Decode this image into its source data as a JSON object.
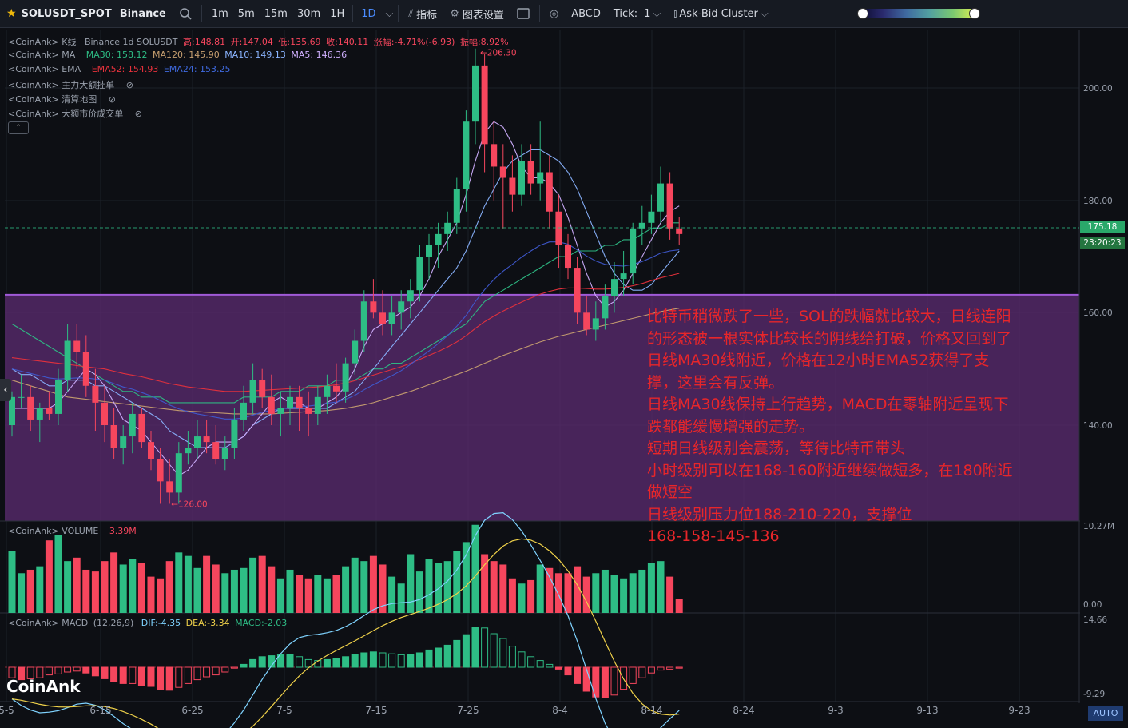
{
  "toolbar": {
    "symbol": "SOLUSDT_SPOT",
    "exchange": "Binance",
    "timeframes": [
      "1m",
      "5m",
      "15m",
      "30m",
      "1H",
      "1D"
    ],
    "active_timeframe": "1D",
    "indicators_label": "指标",
    "chart_settings_label": "图表设置",
    "abcd_label": "ABCD",
    "tick_label": "Tick:",
    "tick_value": "1",
    "cluster_label": "Ask-Bid Cluster"
  },
  "legends": {
    "kline": {
      "prefix": "<CoinAnk> K线",
      "source": "Binance 1d SOLUSDT",
      "high": "高:148.81",
      "open": "开:147.04",
      "low": "低:135.69",
      "close": "收:140.11",
      "change": "涨幅:-4.71%(-6.93)",
      "amplitude": "振幅:8.92%"
    },
    "ma": {
      "prefix": "<CoinAnk> MA",
      "ma30": "MA30: 158.12",
      "ma120": "MA120: 145.90",
      "ma10": "MA10: 149.13",
      "ma5": "MA5: 146.36"
    },
    "ema": {
      "prefix": "<CoinAnk> EMA",
      "ema52": "EMA52: 154.93",
      "ema24": "EMA24: 153.25"
    },
    "hidden": [
      "<CoinAnk> 主力大额挂单",
      "<CoinAnk> 清算地图",
      "<CoinAnk> 大额市价成交单"
    ],
    "volume": {
      "prefix": "<CoinAnk> VOLUME",
      "value": "3.39M"
    },
    "macd": {
      "prefix": "<CoinAnk> MACD",
      "params": "(12,26,9)",
      "dif": "DIF:-4.35",
      "dea": "DEA:-3.34",
      "macd": "MACD:-2.03"
    }
  },
  "price_axis": {
    "labels": [
      "200.00",
      "180.00",
      "160.00",
      "140.00"
    ],
    "current_price": "175.18",
    "countdown": "23:20:23"
  },
  "volume_axis": {
    "labels": [
      "10.27M",
      "0.00"
    ]
  },
  "macd_axis": {
    "labels": [
      "14.66",
      "-9.29"
    ]
  },
  "extremes": {
    "high_label": "206.30",
    "low_label": "126.00"
  },
  "date_axis": [
    "5-5",
    "6-15",
    "6-25",
    "7-5",
    "7-15",
    "7-25",
    "8-4",
    "8-14",
    "8-24",
    "9-3",
    "9-13",
    "9-23"
  ],
  "annotation": [
    "比特币稍微跌了一些，SOL的跌幅就比较大，日线连阳",
    "的形态被一根实体比较长的阴线给打破，价格又回到了",
    "日线MA30线附近，价格在12小时EMA52获得了支",
    "撑，这里会有反弹。",
    "日线MA30线保持上行趋势，MACD在零轴附近呈现下",
    "跌都能缓慢增强的走势。",
    "短期日线级别会震荡，等待比特币带头",
    "小时级别可以在168-160附近继续做短多，在180附近",
    "做短空",
    "日线级别压力位188-210-220，支撑位",
    "168-158-145-136"
  ],
  "logo": "CoinAnk",
  "auto_label": "AUTO",
  "colors": {
    "up": "#2ebd85",
    "down": "#f6465d",
    "zone": "#5a2a6e",
    "ma30": "#2ebd85",
    "ma120": "#c8a070",
    "ma10": "#8ab4ff",
    "ma5": "#d0b0ff",
    "ema52": "#e8323c",
    "ema24": "#3f5ad0"
  },
  "chart_data": {
    "type": "candlestick",
    "title": "Binance 1d SOLUSDT",
    "ylim": [
      120,
      210
    ],
    "zone": [
      129,
      163.2
    ],
    "candles": [
      [
        140,
        146,
        138,
        145
      ],
      [
        145,
        149,
        143,
        145
      ],
      [
        145,
        147,
        139,
        141
      ],
      [
        141,
        144,
        137,
        143
      ],
      [
        143,
        146,
        141,
        142
      ],
      [
        142,
        150,
        140,
        148
      ],
      [
        148,
        158,
        146,
        155
      ],
      [
        155,
        158,
        150,
        153
      ],
      [
        153,
        156,
        145,
        147
      ],
      [
        147,
        150,
        139,
        144
      ],
      [
        144,
        147,
        137,
        140
      ],
      [
        140,
        143,
        134,
        136
      ],
      [
        136,
        140,
        133,
        138
      ],
      [
        138,
        144,
        135,
        142
      ],
      [
        142,
        143,
        136,
        137
      ],
      [
        137,
        139,
        132,
        134
      ],
      [
        134,
        136,
        126,
        130
      ],
      [
        130,
        134,
        126,
        128
      ],
      [
        128,
        137,
        126,
        135
      ],
      [
        135,
        139,
        133,
        136
      ],
      [
        136,
        141,
        134,
        138
      ],
      [
        138,
        141,
        135,
        137
      ],
      [
        137,
        140,
        133,
        134
      ],
      [
        134,
        138,
        132,
        136
      ],
      [
        136,
        143,
        134,
        141
      ],
      [
        141,
        147,
        139,
        144
      ],
      [
        144,
        151,
        142,
        148
      ],
      [
        148,
        150,
        143,
        145
      ],
      [
        145,
        149,
        140,
        142
      ],
      [
        142,
        146,
        138,
        143
      ],
      [
        143,
        147,
        140,
        145
      ],
      [
        145,
        147,
        139,
        143
      ],
      [
        143,
        146,
        138,
        142
      ],
      [
        142,
        147,
        140,
        145
      ],
      [
        145,
        149,
        142,
        147
      ],
      [
        147,
        151,
        144,
        146
      ],
      [
        146,
        152,
        144,
        151
      ],
      [
        151,
        157,
        149,
        155
      ],
      [
        155,
        164,
        153,
        162
      ],
      [
        162,
        166,
        159,
        160
      ],
      [
        160,
        164,
        156,
        158
      ],
      [
        158,
        163,
        156,
        160
      ],
      [
        160,
        164,
        157,
        162
      ],
      [
        162,
        166,
        159,
        164
      ],
      [
        164,
        172,
        162,
        170
      ],
      [
        170,
        174,
        166,
        172
      ],
      [
        172,
        176,
        168,
        174
      ],
      [
        174,
        178,
        171,
        176
      ],
      [
        176,
        184,
        174,
        182
      ],
      [
        182,
        196,
        178,
        194
      ],
      [
        194,
        207,
        190,
        204
      ],
      [
        204,
        206,
        185,
        190
      ],
      [
        190,
        194,
        180,
        186
      ],
      [
        186,
        190,
        175,
        184
      ],
      [
        184,
        188,
        178,
        181
      ],
      [
        181,
        190,
        179,
        187
      ],
      [
        187,
        190,
        181,
        183
      ],
      [
        183,
        194,
        180,
        185
      ],
      [
        185,
        188,
        175,
        178
      ],
      [
        178,
        181,
        168,
        172
      ],
      [
        172,
        174,
        166,
        168
      ],
      [
        168,
        170,
        158,
        160
      ],
      [
        160,
        163,
        156,
        157
      ],
      [
        157,
        162,
        155,
        159
      ],
      [
        159,
        165,
        157,
        163
      ],
      [
        163,
        169,
        160,
        166
      ],
      [
        166,
        171,
        163,
        167
      ],
      [
        167,
        176,
        165,
        175
      ],
      [
        175,
        179,
        172,
        176
      ],
      [
        176,
        181,
        174,
        178
      ],
      [
        178,
        186,
        176,
        183
      ],
      [
        183,
        185,
        173,
        175
      ],
      [
        175,
        177,
        172,
        174
      ]
    ],
    "volume": [
      7.2,
      4.6,
      5.0,
      5.4,
      8.4,
      9.0,
      6.0,
      6.4,
      5.0,
      4.8,
      6.0,
      7.0,
      5.6,
      6.2,
      5.8,
      4.2,
      4.0,
      6.0,
      7.0,
      6.6,
      5.2,
      6.6,
      5.6,
      4.6,
      5.0,
      5.2,
      6.4,
      6.6,
      5.4,
      4.0,
      5.0,
      4.4,
      4.0,
      4.4,
      4.0,
      4.4,
      5.4,
      6.4,
      6.0,
      6.6,
      5.6,
      4.2,
      3.4,
      6.8,
      4.8,
      6.2,
      5.8,
      6.0,
      7.2,
      8.2,
      10.2,
      6.8,
      6.0,
      5.6,
      4.0,
      3.4,
      3.8,
      5.6,
      5.2,
      4.6,
      4.6,
      5.4,
      4.2,
      4.6,
      5.0,
      4.4,
      4.0,
      4.6,
      5.0,
      5.8,
      6.0,
      4.2,
      1.6
    ],
    "macd_hist": [
      -2.2,
      -2.6,
      -2.4,
      -2.2,
      -1.6,
      -1.4,
      -1.0,
      -0.8,
      -1.2,
      -1.8,
      -2.4,
      -3.0,
      -3.4,
      -3.4,
      -3.8,
      -4.0,
      -4.6,
      -4.8,
      -4.2,
      -3.4,
      -2.6,
      -2.0,
      -1.6,
      -1.0,
      -0.2,
      0.6,
      1.6,
      2.2,
      2.4,
      2.6,
      2.6,
      2.2,
      1.6,
      1.4,
      1.6,
      1.8,
      2.2,
      2.6,
      3.0,
      3.2,
      3.0,
      2.8,
      2.6,
      2.6,
      3.0,
      3.6,
      4.0,
      4.6,
      5.6,
      6.8,
      8.4,
      8.2,
      7.0,
      6.0,
      4.4,
      3.2,
      2.2,
      1.4,
      0.6,
      -0.4,
      -1.6,
      -3.4,
      -5.0,
      -6.2,
      -6.4,
      -5.8,
      -4.6,
      -3.4,
      -2.2,
      -1.2,
      -0.6,
      -0.4,
      -0.2
    ],
    "series": [
      {
        "name": "MA30",
        "color": "#2ebd85",
        "values": [
          158,
          157,
          156,
          155,
          154,
          153,
          152,
          151,
          150,
          149,
          148,
          147,
          146,
          146,
          145,
          145,
          145,
          144,
          144,
          144,
          144,
          144,
          144,
          144,
          144,
          145,
          145,
          145,
          145,
          146,
          146,
          146,
          147,
          147,
          147,
          148,
          148,
          148,
          149,
          150,
          150,
          151,
          151,
          152,
          153,
          154,
          155,
          156,
          157,
          158,
          160,
          162,
          163,
          164,
          165,
          166,
          167,
          168,
          169,
          170,
          170,
          171,
          171,
          171,
          172,
          172,
          173,
          173,
          174,
          175,
          175,
          176,
          176
        ]
      },
      {
        "name": "MA120",
        "color": "#c8a070",
        "values": [
          148,
          147.5,
          147,
          146.5,
          146,
          145.5,
          145,
          144.8,
          144.6,
          144.4,
          144.2,
          144,
          143.8,
          143.6,
          143.4,
          143.2,
          143,
          142.8,
          142.6,
          142.5,
          142.4,
          142.3,
          142.2,
          142.1,
          142,
          142,
          142,
          142,
          142,
          142.1,
          142.2,
          142.3,
          142.4,
          142.5,
          142.6,
          142.8,
          143,
          143.3,
          143.6,
          144,
          144.5,
          145,
          145.5,
          146,
          146.6,
          147.2,
          147.8,
          148.4,
          149,
          149.6,
          150.3,
          151,
          151.7,
          152.4,
          153,
          153.6,
          154.2,
          154.8,
          155.3,
          155.8,
          156.2,
          156.6,
          157,
          157.4,
          157.8,
          158.2,
          158.6,
          159,
          159.4,
          159.8,
          160.2,
          160.5,
          160.8
        ]
      },
      {
        "name": "MA10",
        "color": "#8ab4ff",
        "values": [
          150,
          149,
          149,
          148,
          147,
          147,
          148,
          148,
          148,
          147,
          147,
          146,
          145,
          144,
          143,
          142,
          141,
          139,
          138,
          137,
          136,
          136,
          136,
          136,
          137,
          138,
          140,
          141,
          142,
          143,
          143,
          143,
          143,
          143,
          143,
          144,
          145,
          146,
          148,
          150,
          152,
          154,
          156,
          158,
          160,
          162,
          164,
          166,
          168,
          171,
          175,
          179,
          182,
          185,
          187,
          188,
          189,
          189,
          188,
          187,
          185,
          182,
          178,
          174,
          170,
          167,
          165,
          164,
          164,
          165,
          167,
          169,
          171
        ]
      },
      {
        "name": "MA5",
        "color": "#d0b0ff",
        "values": [
          143,
          143,
          143,
          143,
          143,
          144,
          146,
          148,
          150,
          149,
          147,
          144,
          141,
          140,
          139,
          137,
          135,
          133,
          131,
          132,
          134,
          136,
          137,
          137,
          137,
          138,
          140,
          142,
          144,
          145,
          144,
          144,
          143,
          143,
          144,
          145,
          147,
          150,
          154,
          157,
          158,
          159,
          160,
          161,
          163,
          166,
          170,
          173,
          176,
          181,
          187,
          192,
          194,
          193,
          190,
          186,
          184,
          184,
          183,
          181,
          177,
          172,
          167,
          163,
          161,
          162,
          164,
          167,
          170,
          173,
          176,
          178,
          179
        ]
      },
      {
        "name": "EMA52",
        "color": "#e8323c",
        "values": [
          152,
          151.8,
          151.6,
          151.4,
          151.2,
          151,
          150.8,
          150.6,
          150.4,
          150.2,
          150,
          149.6,
          149.2,
          148.9,
          148.6,
          148.2,
          147.8,
          147.4,
          147.1,
          146.8,
          146.6,
          146.4,
          146.2,
          146,
          146,
          146,
          146.1,
          146.2,
          146.3,
          146.4,
          146.5,
          146.6,
          146.7,
          146.8,
          147,
          147.2,
          147.5,
          147.9,
          148.4,
          148.9,
          149.4,
          149.9,
          150.4,
          151,
          151.7,
          152.4,
          153.1,
          153.9,
          154.8,
          155.9,
          157.2,
          158.4,
          159.4,
          160.3,
          161.1,
          161.9,
          162.6,
          163.3,
          163.8,
          164.2,
          164.4,
          164.4,
          164.3,
          164.2,
          164.2,
          164.3,
          164.5,
          164.8,
          165.2,
          165.7,
          166.2,
          166.6,
          167
        ]
      },
      {
        "name": "EMA24",
        "color": "#3f5ad0",
        "values": [
          150,
          149.6,
          149.2,
          148.8,
          148.4,
          148.2,
          148.3,
          148.4,
          148.4,
          148.2,
          148,
          147.4,
          146.8,
          146.4,
          145.8,
          145.2,
          144.4,
          143.6,
          142.9,
          142.4,
          142,
          141.7,
          141.4,
          141.1,
          141.1,
          141.3,
          141.8,
          142.3,
          142.6,
          142.9,
          143.1,
          143.3,
          143.4,
          143.6,
          143.9,
          144.1,
          144.6,
          145.3,
          146.3,
          147.2,
          148,
          148.8,
          149.7,
          150.8,
          152,
          153.2,
          154.5,
          155.9,
          157.6,
          159.5,
          162,
          164.1,
          165.9,
          167.4,
          168.6,
          169.9,
          171,
          172,
          172.6,
          172.6,
          172.2,
          171.2,
          170.1,
          169.2,
          168.6,
          168.4,
          168.3,
          168.6,
          169.1,
          169.8,
          170.6,
          171,
          171.2
        ]
      }
    ]
  }
}
